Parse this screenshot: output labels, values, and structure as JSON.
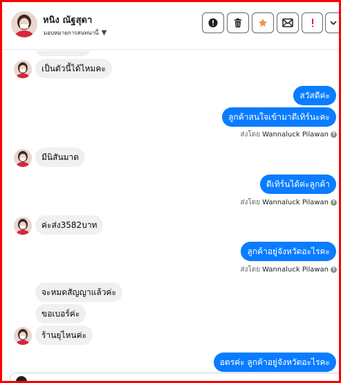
{
  "contact": {
    "name": "หนิง ณัฐสุดา",
    "assign_label": "มอบหมายการสนทนานี้"
  },
  "toolbar": {
    "icons": [
      "info-icon",
      "trash-icon",
      "star-icon",
      "mark-unread-icon",
      "spam-icon",
      "more-icon"
    ],
    "accent_star": "#f7923b",
    "accent_alert": "#e41e3f"
  },
  "messages": {
    "m0": "",
    "m1": "เป็นตัวนี้ได้ไหมคะ",
    "m2": "สวัสดีค่ะ",
    "m3": "ลูกค้าสนใจเข้ามาดีเทิร์นะคะ",
    "m4": "มีนิสันมาด",
    "m5": "ดีเทิร์นได้ค่ะลูกค้า",
    "m6": "ค่ะส่ง3582บาท",
    "m7": "ลูกค้าอยู่จังหวัดอะไรคะ",
    "m8": "จะหมดสัญญาแล้วค่ะ",
    "m9": "ขอเบอร์ค่ะ",
    "m10": "ร้านยุไหนค่ะ",
    "m11": "อตรค่ะ  ลูกค้าอยู่จังหวัดอะไรคะ"
  },
  "sent_by": {
    "prefix": "ส่งโดย",
    "agent": "Wannaluck Pilawan"
  },
  "colors": {
    "outgoing": "#0a7cff",
    "incoming": "#f0f0f0",
    "frame": "#ff0000"
  }
}
